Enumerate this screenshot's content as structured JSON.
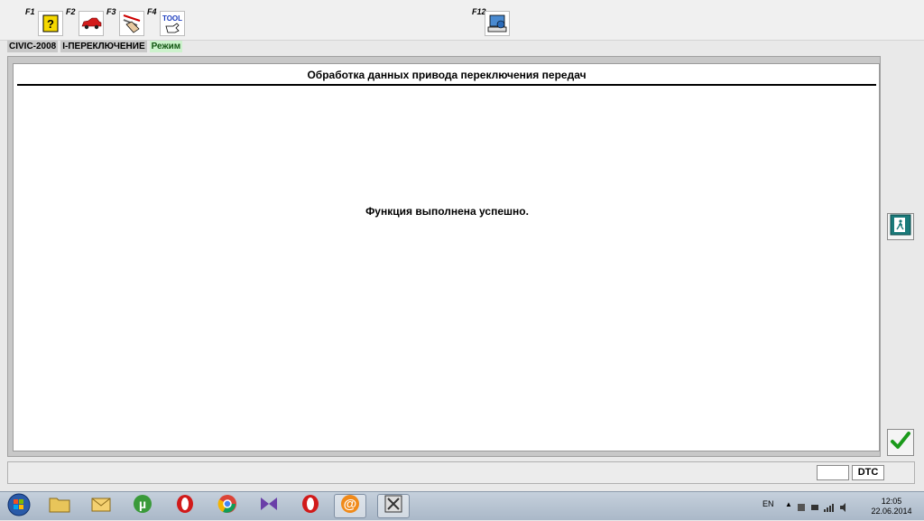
{
  "toolbar": {
    "f1": {
      "label": "F1",
      "icon": "help-book-icon"
    },
    "f2": {
      "label": "F2",
      "icon": "car-icon"
    },
    "f3": {
      "label": "F3",
      "icon": "data-list-hand-icon"
    },
    "f4": {
      "label": "F4",
      "icon": "tool-hand-icon",
      "tool_text": "TOOL"
    },
    "f12": {
      "label": "F12",
      "icon": "computer-print-icon"
    }
  },
  "breadcrumb": {
    "model": "CIVIC-2008",
    "system": "I-ПЕРЕКЛЮЧЕНИЕ",
    "mode": "Режим"
  },
  "panel": {
    "title": "Обработка данных привода переключения передач",
    "message": "Функция выполнена успешно."
  },
  "side_buttons": {
    "exit": {
      "icon": "exit-door-icon"
    },
    "ok": {
      "icon": "checkmark-icon",
      "color": "#1a9a1a"
    }
  },
  "status": {
    "dtc_label": "DTC"
  },
  "taskbar": {
    "lang": "EN",
    "time": "12:05",
    "date": "22.06.2014"
  }
}
